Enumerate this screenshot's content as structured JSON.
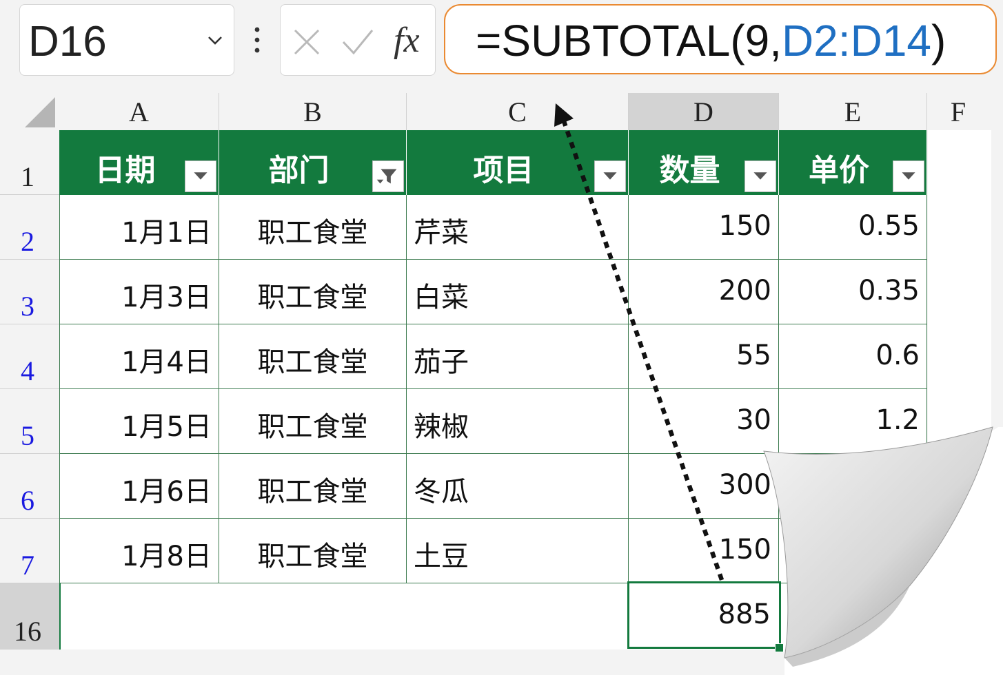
{
  "name_box": {
    "value": "D16"
  },
  "formula_bar": {
    "fx_label": "fx",
    "formula_prefix": "=SUBTOTAL(9,",
    "formula_ref": "D2:D14",
    "formula_suffix": ")",
    "accent_color": "#ea8a32",
    "ref_color": "#1f6fc2"
  },
  "grid": {
    "columns": [
      "A",
      "B",
      "C",
      "D",
      "E",
      "F"
    ],
    "selected_column": "D",
    "row_numbers": [
      "1",
      "2",
      "3",
      "4",
      "5",
      "6",
      "7",
      "16"
    ],
    "selected_row": "16",
    "header_fill": "#137a3e",
    "headers": [
      "日期",
      "部门",
      "项目",
      "数量",
      "单价"
    ],
    "rows": [
      [
        "1月1日",
        "职工食堂",
        "芹菜",
        "150",
        "0.55"
      ],
      [
        "1月3日",
        "职工食堂",
        "白菜",
        "200",
        "0.35"
      ],
      [
        "1月4日",
        "职工食堂",
        "茄子",
        "55",
        "0.6"
      ],
      [
        "1月5日",
        "职工食堂",
        "辣椒",
        "30",
        "1.2"
      ],
      [
        "1月6日",
        "职工食堂",
        "冬瓜",
        "300",
        ""
      ],
      [
        "1月8日",
        "职工食堂",
        "土豆",
        "150",
        ""
      ]
    ],
    "total_cell": {
      "address": "D16",
      "value": "885"
    }
  },
  "icons": {
    "dropdown": "chevron-down-icon",
    "more": "more-vertical-icon",
    "cancel": "close-icon",
    "enter": "check-icon",
    "filter_active": "filter-icon"
  }
}
